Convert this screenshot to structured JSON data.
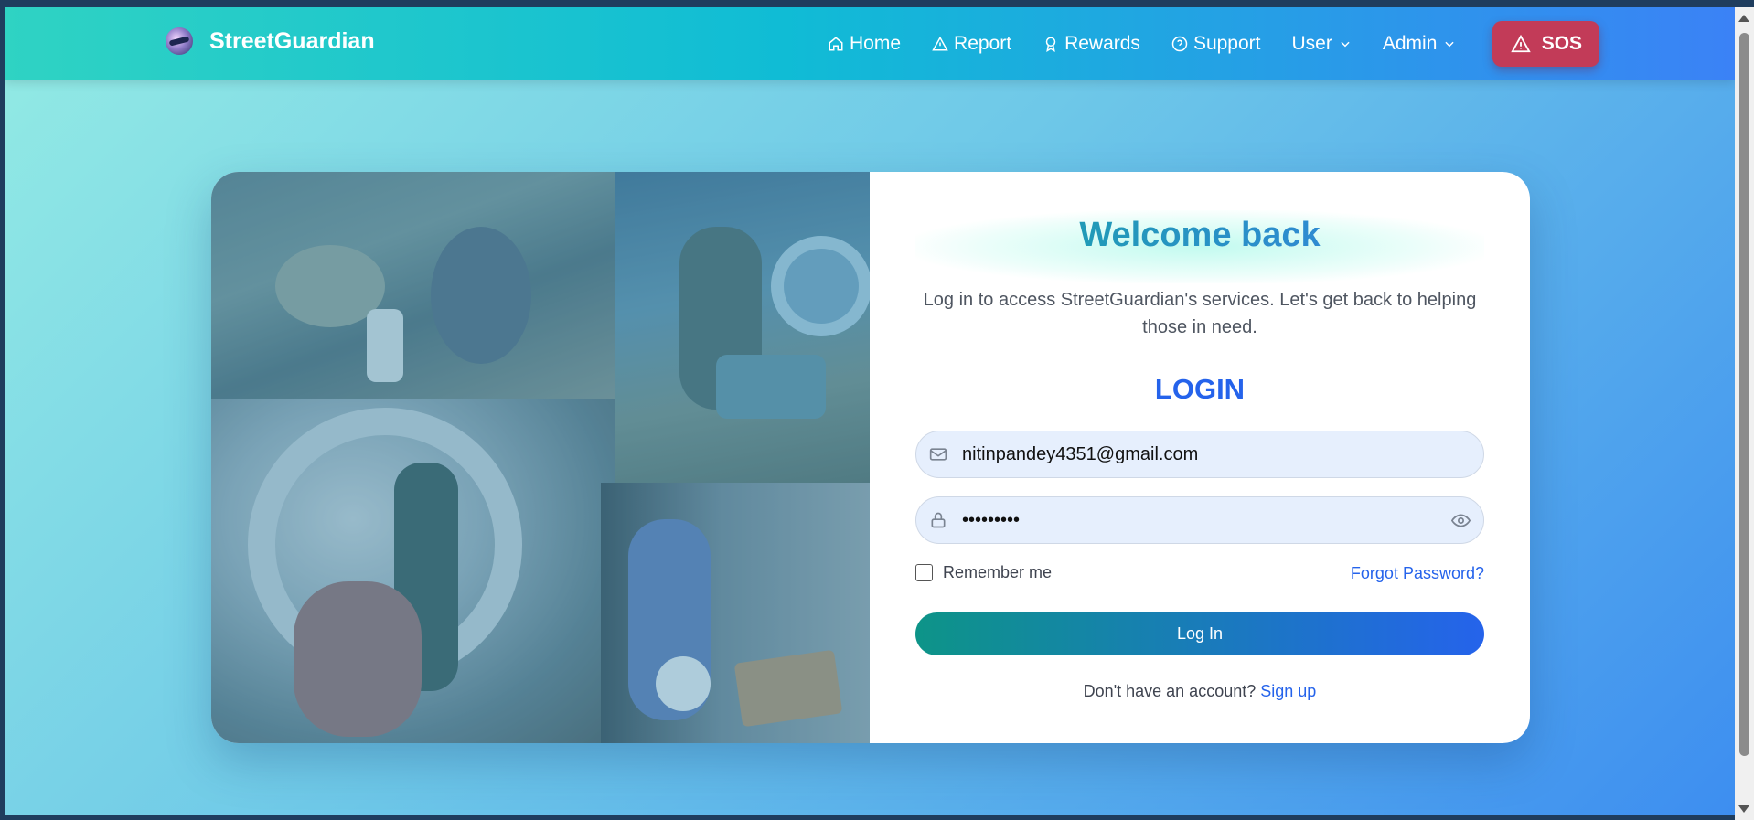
{
  "brand": {
    "name": "StreetGuardian"
  },
  "nav": {
    "items": [
      {
        "label": "Home",
        "icon": "home-icon"
      },
      {
        "label": "Report",
        "icon": "warning-icon"
      },
      {
        "label": "Rewards",
        "icon": "award-icon"
      },
      {
        "label": "Support",
        "icon": "help-circle-icon"
      },
      {
        "label": "User",
        "icon": "chevron-down-icon"
      },
      {
        "label": "Admin",
        "icon": "chevron-down-icon"
      }
    ],
    "sos_label": "SOS"
  },
  "login": {
    "welcome_title": "Welcome back",
    "subtitle": "Log in to access StreetGuardian's services. Let's get back to helping those in need.",
    "heading": "LOGIN",
    "email_value": "nitinpandey4351@gmail.com",
    "password_value": "•••••••••",
    "remember_label": "Remember me",
    "forgot_label": "Forgot Password?",
    "submit_label": "Log In",
    "signup_prompt": "Don't have an account?",
    "signup_link": "Sign up"
  },
  "colors": {
    "navbar_start": "#2fd3c3",
    "navbar_end": "#3b82f6",
    "sos": "#c23b58",
    "primary": "#2563eb",
    "button_start": "#0d9488"
  }
}
